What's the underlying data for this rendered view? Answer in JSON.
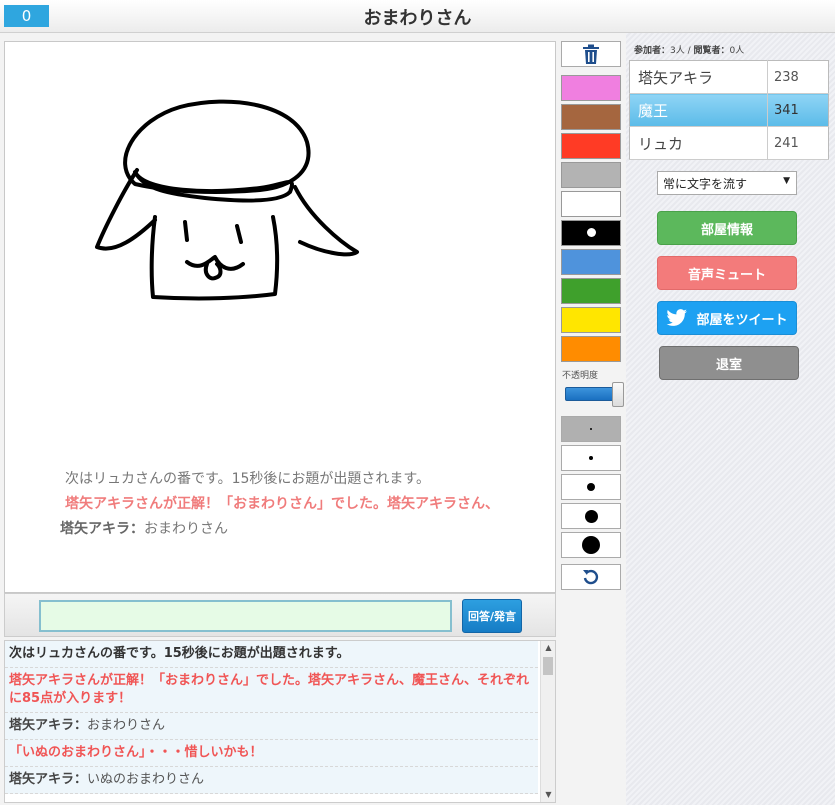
{
  "header": {
    "timer": "0",
    "title": "おまわりさん"
  },
  "canvas": {
    "overlay": {
      "line1": "次はリュカさんの番です。15秒後にお題が出題されます。",
      "line2": "塔矢アキラさんが正解！「おまわりさん」でした。塔矢アキラさん、",
      "line3_name": "塔矢アキラ：",
      "line3_msg": "おまわりさん"
    }
  },
  "tools": {
    "palette": [
      "#f07fe0",
      "#a5663f",
      "#ff3b25",
      "#b3b3b3",
      "#ffffff",
      "#000000",
      "#4f93dc",
      "#3fa02c",
      "#ffe600",
      "#ff8c00"
    ],
    "opacity_label": "不透明度",
    "opacity_value": 0.9,
    "brush_sizes": [
      2,
      4,
      8,
      13,
      18
    ]
  },
  "chat": {
    "input_value": "",
    "send_label": "回答/発言",
    "log": [
      {
        "type": "sys",
        "text": "次はリュカさんの番です。15秒後にお題が出題されます。"
      },
      {
        "type": "red",
        "text": "塔矢アキラさんが正解！「おまわりさん」でした。塔矢アキラさん、魔王さん、それぞれに85点が入ります！"
      },
      {
        "type": "user",
        "name": "塔矢アキラ：",
        "msg": "おまわりさん"
      },
      {
        "type": "red",
        "text": "「いぬのおまわりさん」・・・惜しいかも！"
      },
      {
        "type": "user",
        "name": "塔矢アキラ：",
        "msg": "いぬのおまわりさん"
      }
    ]
  },
  "sidebar": {
    "participants_label": "参加者：",
    "participants_count": "3人",
    "separator": " / ",
    "viewers_label": "閲覧者：",
    "viewers_count": "0人",
    "players": [
      {
        "name": "塔矢アキラ",
        "score": "238",
        "active": false
      },
      {
        "name": "魔王",
        "score": "341",
        "active": true
      },
      {
        "name": "リュカ",
        "score": "241",
        "active": false
      }
    ],
    "flow_select": "常に文字を流す",
    "room_info": "部屋情報",
    "mute": "音声ミュート",
    "tweet": "部屋をツイート",
    "exit": "退室"
  },
  "colors": {
    "accent": "#2fa6df",
    "info": "#5cb85c",
    "mute": "#f37b7b",
    "tweet": "#1da1f2",
    "exit": "#8f8f8f"
  },
  "icons": [
    "trash-icon",
    "undo-icon",
    "twitter-bird-icon",
    "chevron-down-icon"
  ]
}
